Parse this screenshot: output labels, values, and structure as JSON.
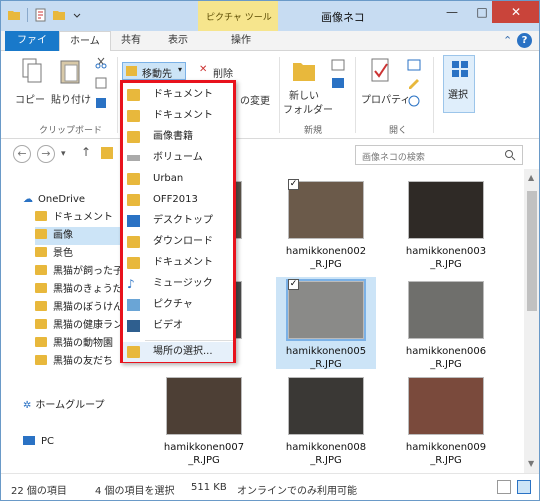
{
  "titlebar": {
    "title": "画像ネコ",
    "context_tab": "ピクチャ ツール"
  },
  "tabs": {
    "file": "ファイル",
    "home": "ホーム",
    "share": "共有",
    "view": "表示",
    "manage": "操作"
  },
  "ribbon": {
    "copy": "コピー",
    "paste": "貼り付け",
    "clipboard_group": "クリップボード",
    "move_to": "移動先",
    "delete": "削除",
    "rename_partial": "の変更",
    "new_folder_1": "新しい",
    "new_folder_2": "フォルダー",
    "new_group": "新規",
    "properties": "プロパティ",
    "open_group": "開く",
    "select": "選択"
  },
  "search": {
    "placeholder": "画像ネコの検索"
  },
  "nav": {
    "onedrive": "OneDrive",
    "items": [
      {
        "label": "ドキュメント"
      },
      {
        "label": "画像"
      },
      {
        "label": "景色"
      },
      {
        "label": "黒猫が飼った子"
      },
      {
        "label": "黒猫のきょうだい"
      },
      {
        "label": "黒猫のぼうけん"
      },
      {
        "label": "黒猫の健康ラン"
      },
      {
        "label": "黒猫の動物園"
      },
      {
        "label": "黒猫の友だち"
      }
    ],
    "homegroup": "ホームグループ",
    "pc": "PC"
  },
  "menu": {
    "items": [
      {
        "label": "ドキュメント"
      },
      {
        "label": "ドキュメント"
      },
      {
        "label": "画像書籍"
      },
      {
        "label": "ボリューム"
      },
      {
        "label": "Urban"
      },
      {
        "label": "OFF2013"
      },
      {
        "label": "デスクトップ"
      },
      {
        "label": "ダウンロード"
      },
      {
        "label": "ドキュメント"
      },
      {
        "label": "ミュージック"
      },
      {
        "label": "ピクチャ"
      },
      {
        "label": "ビデオ"
      }
    ],
    "choose_location": "場所の選択..."
  },
  "files": [
    {
      "name1": "",
      "name2": "01",
      "checked": false,
      "selected": false
    },
    {
      "name1": "hamikkonen002",
      "name2": "_R.JPG",
      "checked": true,
      "selected": false
    },
    {
      "name1": "hamikkonen003",
      "name2": "_R.JPG",
      "checked": false,
      "selected": false
    },
    {
      "name1": "",
      "name2": "04",
      "checked": false,
      "selected": false
    },
    {
      "name1": "hamikkonen005",
      "name2": "_R.JPG",
      "checked": true,
      "selected": true
    },
    {
      "name1": "hamikkonen006",
      "name2": "_R.JPG",
      "checked": false,
      "selected": false
    },
    {
      "name1": "hamikkonen007",
      "name2": "_R.JPG",
      "checked": false,
      "selected": false
    },
    {
      "name1": "hamikkonen008",
      "name2": "_R.JPG",
      "checked": false,
      "selected": false
    },
    {
      "name1": "hamikkonen009",
      "name2": "_R.JPG",
      "checked": false,
      "selected": false
    }
  ],
  "status": {
    "count": "22 個の項目",
    "selected": "4 個の項目を選択",
    "size": "511 KB",
    "online": "オンラインでのみ利用可能"
  },
  "colors": {
    "accent": "#1979ca",
    "highlight_border": "#e8121c",
    "selection": "#cce4f7"
  }
}
